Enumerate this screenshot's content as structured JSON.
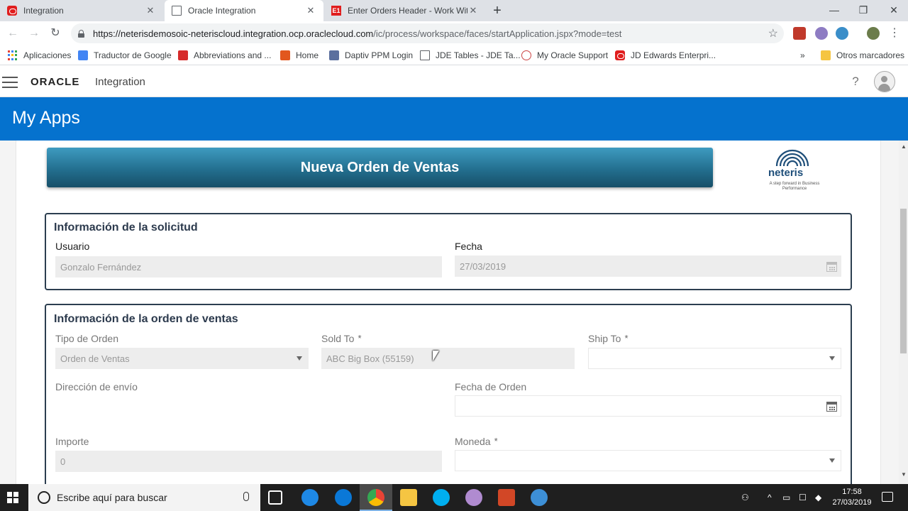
{
  "browser": {
    "tabs": [
      {
        "title": "Integration",
        "favicon": "oracle-icon",
        "active": false
      },
      {
        "title": "Oracle Integration",
        "favicon": "page-icon",
        "active": true
      },
      {
        "title": "Enter Orders Header - Work With",
        "favicon": "e1-icon",
        "active": false
      }
    ],
    "favicon_e1_text": "E1",
    "new_tab": "+",
    "window_controls": {
      "minimize": "—",
      "restore": "❐",
      "close": "✕"
    },
    "url_host": "https://neterisdemosoic-neteriscloud.integration.ocp.oraclecloud.com",
    "url_path": "/ic/process/workspace/faces/startApplication.jspx?mode=test",
    "bookmarks": [
      {
        "label": "Aplicaciones",
        "icon": "apps-grid-icon"
      },
      {
        "label": "Traductor de Google",
        "icon": "google-translate-icon"
      },
      {
        "label": "Abbreviations and ...",
        "icon": "af-icon"
      },
      {
        "label": "Home",
        "icon": "office-icon"
      },
      {
        "label": "Daptiv PPM Login",
        "icon": "daptiv-icon"
      },
      {
        "label": "JDE Tables - JDE Ta...",
        "icon": "page-icon"
      },
      {
        "label": "My Oracle Support",
        "icon": "support-icon"
      },
      {
        "label": "JD Edwards Enterpri...",
        "icon": "oracle-icon"
      }
    ],
    "bookmarks_more": "»",
    "other_bookmarks": "Otros marcadores"
  },
  "app": {
    "brand": "ORACLE",
    "product": "Integration",
    "help_symbol": "?",
    "banner_title": "My Apps"
  },
  "form": {
    "title": "Nueva Orden de Ventas",
    "logo": {
      "word": "neteris",
      "tagline": "A step forward in Business Performance"
    },
    "solicitud": {
      "title": "Información de la solicitud",
      "usuario_label": "Usuario",
      "usuario_value": "Gonzalo Fernández",
      "fecha_label": "Fecha",
      "fecha_value": "27/03/2019"
    },
    "orden": {
      "title": "Información de la orden de ventas",
      "tipo_label": "Tipo de Orden",
      "tipo_value": "Orden de Ventas",
      "sold_to_label": "Sold To",
      "sold_to_value": "ABC Big Box (55159)",
      "ship_to_label": "Ship To",
      "ship_to_value": "",
      "direccion_label": "Dirección de envío",
      "fecha_orden_label": "Fecha de Orden",
      "fecha_orden_value": "",
      "importe_label": "Importe",
      "importe_value": "0",
      "moneda_label": "Moneda",
      "moneda_value": "",
      "required_mark": "*"
    }
  },
  "taskbar": {
    "search_placeholder": "Escribe aquí para buscar",
    "time": "17:58",
    "date": "27/03/2019"
  },
  "colors": {
    "banner": "#0572ce",
    "title_button": "#236f8f",
    "section_border": "#2c3e50"
  }
}
